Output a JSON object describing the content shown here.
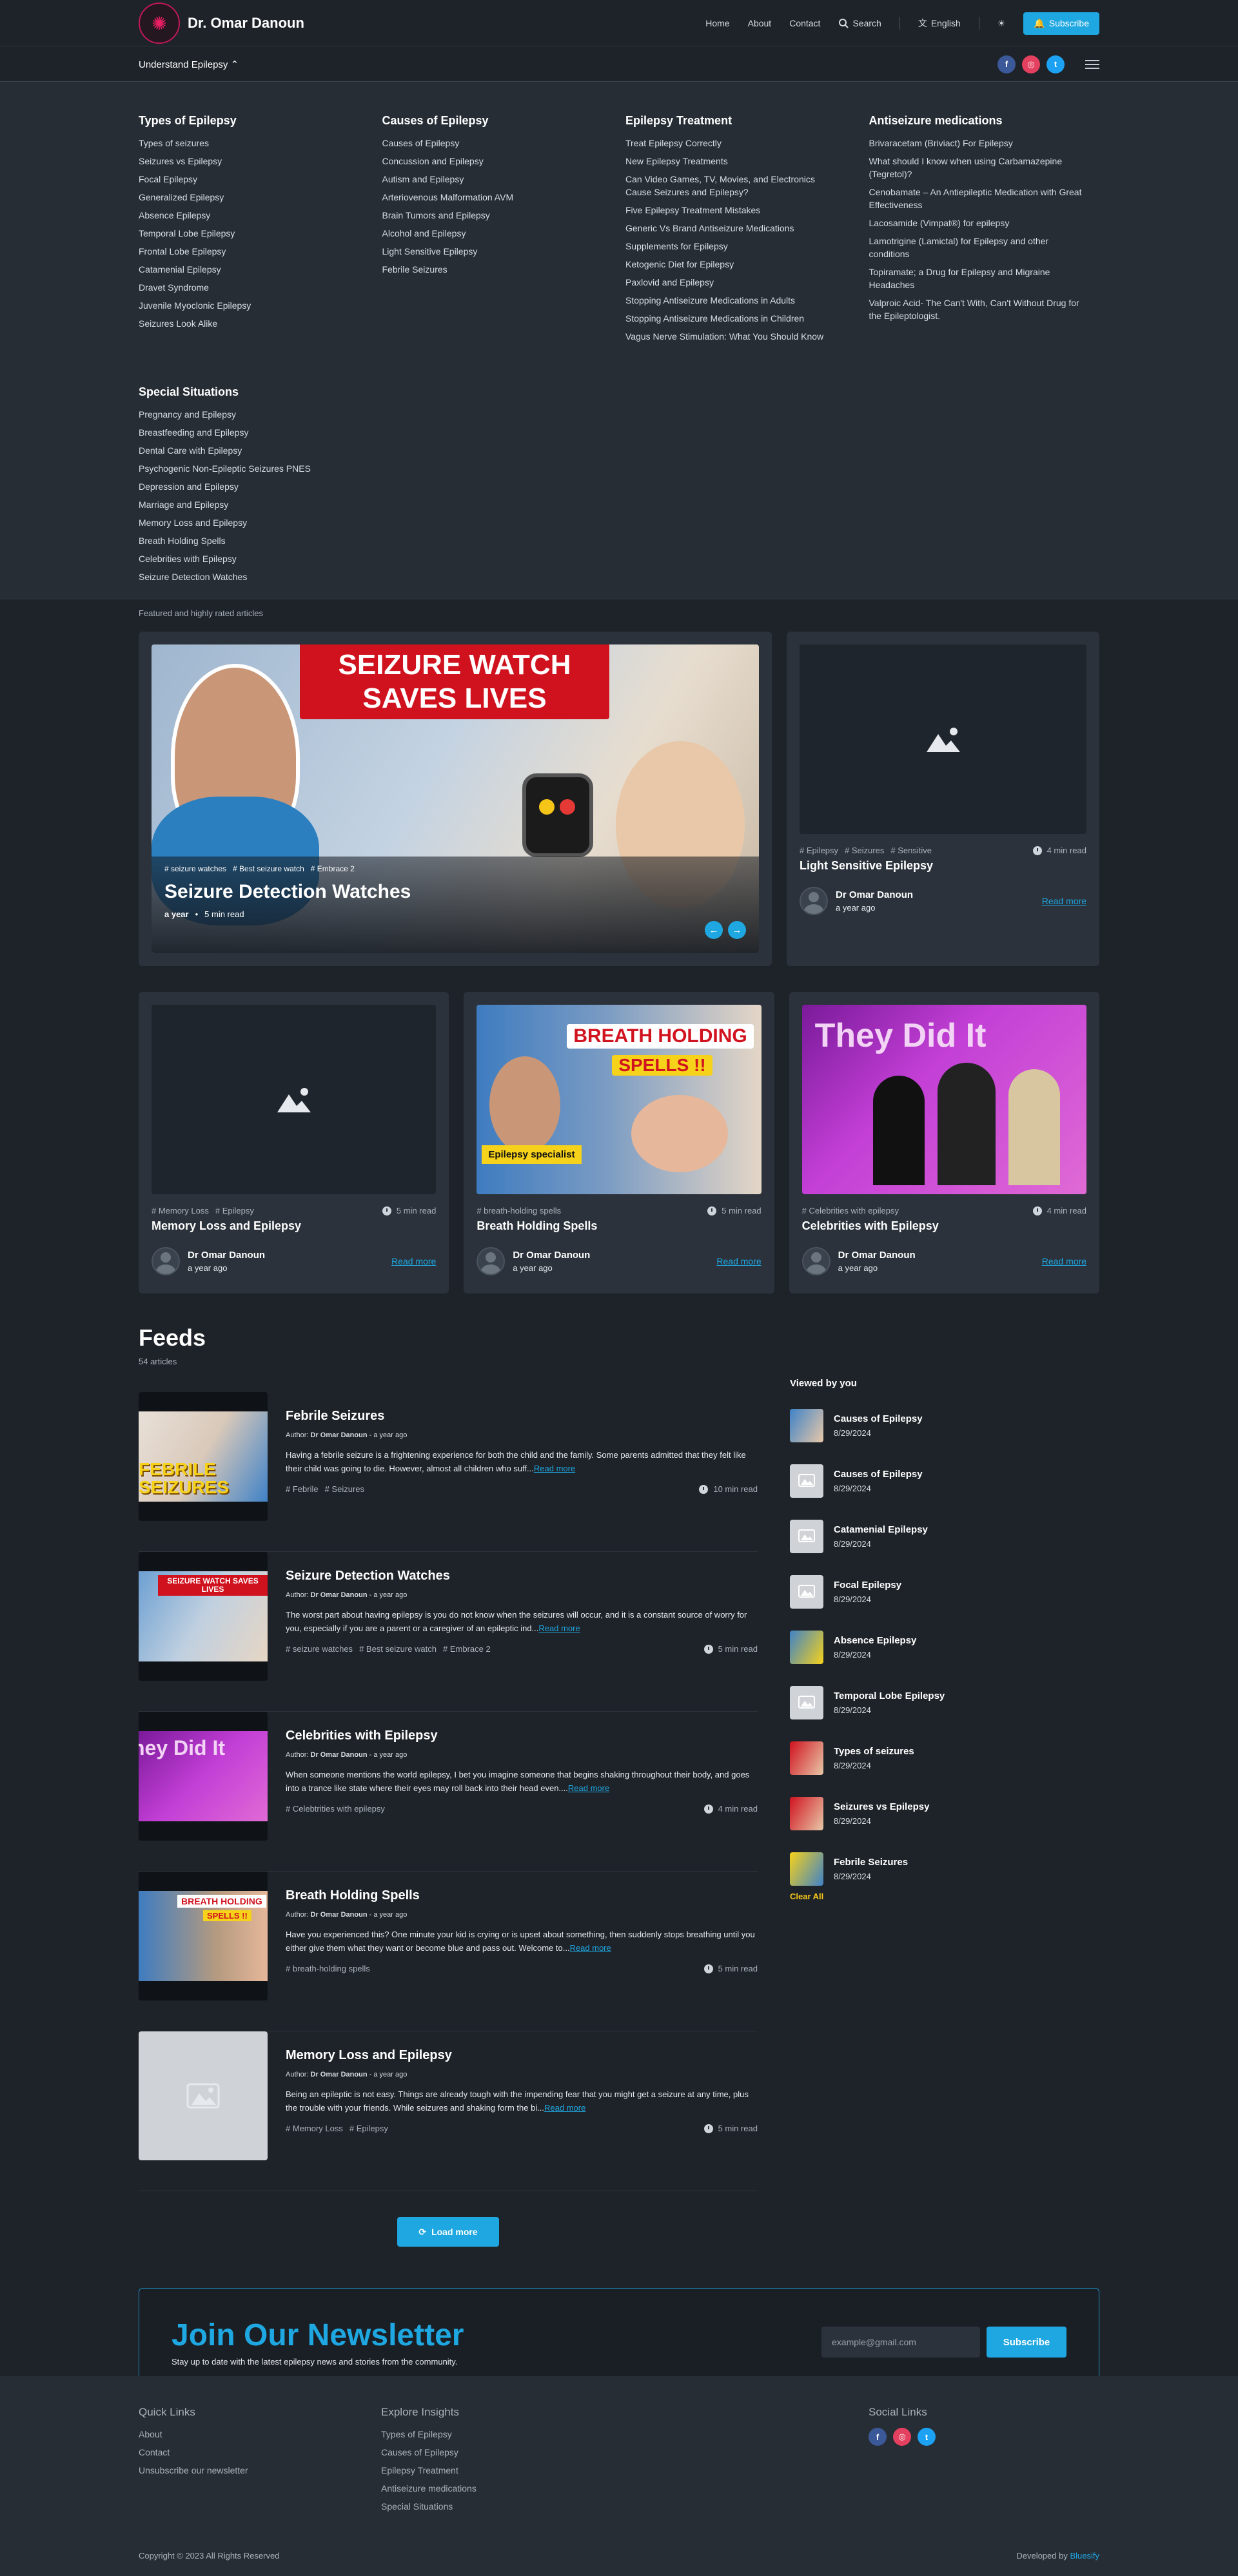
{
  "header": {
    "logo_text": "Dr. Omar Danoun",
    "nav": [
      "Home",
      "About",
      "Contact"
    ],
    "search_label": "Search",
    "language_label": "English",
    "subscribe_label": "Subscribe"
  },
  "subbar": {
    "understand_label": "Understand Epilepsy ⌃"
  },
  "mega": {
    "columns": [
      {
        "title": "Types of Epilepsy",
        "items": [
          "Types of seizures",
          "Seizures vs Epilepsy",
          "Focal Epilepsy",
          "Generalized Epilepsy",
          "Absence Epilepsy",
          "Temporal Lobe Epilepsy",
          "Frontal Lobe Epilepsy",
          "Catamenial Epilepsy",
          "Dravet Syndrome",
          "Juvenile Myoclonic Epilepsy",
          "Seizures Look Alike"
        ]
      },
      {
        "title": "Causes of Epilepsy",
        "items": [
          "Causes of Epilepsy",
          "Concussion and Epilepsy",
          "Autism and Epilepsy",
          "Arteriovenous Malformation AVM",
          "Brain Tumors and Epilepsy",
          "Alcohol and Epilepsy",
          "Light Sensitive Epilepsy",
          "Febrile Seizures"
        ]
      },
      {
        "title": "Epilepsy Treatment",
        "items": [
          "Treat Epilepsy Correctly",
          "New Epilepsy Treatments",
          "Can Video Games, TV, Movies, and Electronics Cause Seizures and Epilepsy?",
          "Five Epilepsy Treatment Mistakes",
          "Generic Vs Brand Antiseizure Medications",
          "Supplements for Epilepsy",
          "Ketogenic Diet for Epilepsy",
          "Paxlovid and Epilepsy",
          "Stopping Antiseizure Medications in Adults",
          "Stopping Antiseizure Medications in Children",
          "Vagus Nerve Stimulation: What You Should Know"
        ]
      },
      {
        "title": "Antiseizure medications",
        "items": [
          "Brivaracetam (Briviact) For Epilepsy",
          "What should I know when using Carbamazepine (Tegretol)?",
          "Cenobamate – An Antiepileptic Medication with Great Effectiveness",
          "Lacosamide (Vimpat®) for epilepsy",
          "Lamotrigine (Lamictal) for Epilepsy and other conditions",
          "Topiramate; a Drug for Epilepsy and Migraine Headaches",
          "Valproic Acid- The Can't With, Can't Without Drug for the Epileptologist."
        ]
      }
    ],
    "special": {
      "title": "Special Situations",
      "items": [
        "Pregnancy and Epilepsy",
        "Breastfeeding and Epilepsy",
        "Dental Care with Epilepsy",
        "Psychogenic Non-Epileptic Seizures PNES",
        "Depression and Epilepsy",
        "Marriage and Epilepsy",
        "Memory Loss and Epilepsy",
        "Breath Holding Spells",
        "Celebrities with Epilepsy",
        "Seizure Detection Watches"
      ]
    }
  },
  "featured": {
    "label": "Featured and highly rated articles",
    "hero": {
      "banner_line1": "SEIZURE WATCH",
      "banner_line2": "SAVES LIVES",
      "tags": [
        "# seizure watches",
        "# Best seizure watch",
        "# Embrace 2"
      ],
      "title": "Seizure Detection Watches",
      "time": "a year",
      "separator": "•",
      "read": "5 min read"
    },
    "cards": [
      {
        "tags": [
          "# Epilepsy",
          "# Seizures",
          "# Sensitive"
        ],
        "read": "4 min read",
        "title": "Light Sensitive Epilepsy",
        "author": "Dr Omar Danoun",
        "time": "a year ago",
        "read_more": "Read more"
      },
      {
        "tags": [
          "# Memory Loss",
          "# Epilepsy"
        ],
        "read": "5 min read",
        "title": "Memory Loss and Epilepsy",
        "author": "Dr Omar Danoun",
        "time": "a year ago",
        "read_more": "Read more"
      },
      {
        "tags": [
          "# breath-holding spells"
        ],
        "read": "5 min read",
        "title": "Breath Holding Spells",
        "author": "Dr Omar Danoun",
        "time": "a year ago",
        "read_more": "Read more",
        "img_label1": "BREATH HOLDING",
        "img_label2": "SPELLS !!",
        "img_badge": "Epilepsy specialist"
      },
      {
        "tags": [
          "# Celebrities with epilepsy"
        ],
        "read": "4 min read",
        "title": "Celebrities with Epilepsy",
        "author": "Dr Omar Danoun",
        "time": "a year ago",
        "read_more": "Read more",
        "img_title": "They Did It"
      }
    ]
  },
  "feeds": {
    "title": "Feeds",
    "count": "54 articles",
    "author_prefix": "Author:",
    "items": [
      {
        "title": "Febrile Seizures",
        "author": "Dr Omar Danoun",
        "time": "- a year ago",
        "excerpt": "Having a febrile seizure is a frightening experience for both the child and the family. Some parents admitted that they felt like their child was going to die. However, almost all children who suff...",
        "read_more": "Read more",
        "tags": [
          "# Febrile",
          "# Seizures"
        ],
        "read": "10 min read",
        "thumb_text": "FEBRILE SEIZURES"
      },
      {
        "title": "Seizure Detection Watches",
        "author": "Dr Omar Danoun",
        "time": "- a year ago",
        "excerpt": "The worst part about having epilepsy is you do not know when the seizures will occur, and it is a constant source of worry for you, especially if you are a parent or a caregiver of an epileptic ind...",
        "read_more": "Read more",
        "tags": [
          "# seizure watches",
          "# Best seizure watch",
          "# Embrace 2"
        ],
        "read": "5 min read",
        "thumb_text": "SEIZURE WATCH SAVES LIVES"
      },
      {
        "title": "Celebrities with Epilepsy",
        "author": "Dr Omar Danoun",
        "time": "- a year ago",
        "excerpt": "When someone mentions the world epilepsy, I bet you imagine someone that begins shaking throughout their body, and goes into a trance like state where their eyes may roll back into their head even....",
        "read_more": "Read more",
        "tags": [
          "# Celebtrities with epilepsy"
        ],
        "read": "4 min read",
        "thumb_text": "hey Did It"
      },
      {
        "title": "Breath Holding Spells",
        "author": "Dr Omar Danoun",
        "time": "- a year ago",
        "excerpt": "Have you experienced this? One minute your kid is crying or is upset about something, then suddenly stops breathing until you either give them what they want or become blue and pass out. Welcome to...",
        "read_more": "Read more",
        "tags": [
          "# breath-holding spells"
        ],
        "read": "5 min read",
        "thumb_text": "BREATH HOLDING",
        "thumb_text2": "SPELLS !!"
      },
      {
        "title": "Memory Loss and Epilepsy",
        "author": "Dr Omar Danoun",
        "time": "- a year ago",
        "excerpt": "Being an epileptic is not easy. Things are already tough with the impending fear that you might get a seizure at any time, plus the trouble with your friends. While seizures and shaking form the bi...",
        "read_more": "Read more",
        "tags": [
          "# Memory Loss",
          "# Epilepsy"
        ],
        "read": "5 min read"
      }
    ],
    "load_more": "Load more"
  },
  "viewed": {
    "title": "Viewed by you",
    "items": [
      {
        "name": "Causes of Epilepsy",
        "date": "8/29/2024"
      },
      {
        "name": "Causes of Epilepsy",
        "date": "8/29/2024"
      },
      {
        "name": "Catamenial Epilepsy",
        "date": "8/29/2024"
      },
      {
        "name": "Focal Epilepsy",
        "date": "8/29/2024"
      },
      {
        "name": "Absence Epilepsy",
        "date": "8/29/2024"
      },
      {
        "name": "Temporal Lobe Epilepsy",
        "date": "8/29/2024"
      },
      {
        "name": "Types of seizures",
        "date": "8/29/2024"
      },
      {
        "name": "Seizures vs Epilepsy",
        "date": "8/29/2024"
      },
      {
        "name": "Febrile Seizures",
        "date": "8/29/2024"
      }
    ],
    "clear_all": "Clear All"
  },
  "newsletter": {
    "title": "Join Our Newsletter",
    "subtitle": "Stay up to date with the latest epilepsy news and stories from the community.",
    "placeholder": "example@gmail.com",
    "button": "Subscribe"
  },
  "footer": {
    "quick_title": "Quick Links",
    "quick_links": [
      "About",
      "Contact",
      "Unsubscribe our newsletter"
    ],
    "explore_title": "Explore Insights",
    "explore_links": [
      "Types of Epilepsy",
      "Causes of Epilepsy",
      "Epilepsy Treatment",
      "Antiseizure medications",
      "Special Situations"
    ],
    "social_title": "Social Links",
    "copyright": "Copyright © 2023 All Rights Reserved",
    "developed_prefix": "Developed by",
    "developed_brand": "Bluesify"
  },
  "colors": {
    "accent": "#1ea7e1",
    "background": "#1e2329",
    "panel": "#262d35",
    "card": "#2b323b",
    "clear_all": "#f6c518"
  },
  "icons": [
    "logo-icon",
    "search-icon",
    "globe-icon",
    "sun-icon",
    "bell-icon",
    "facebook-icon",
    "instagram-icon",
    "twitter-icon",
    "menu-icon",
    "image-placeholder-icon",
    "clock-icon",
    "refresh-icon",
    "arrow-left-icon",
    "arrow-right-icon"
  ]
}
